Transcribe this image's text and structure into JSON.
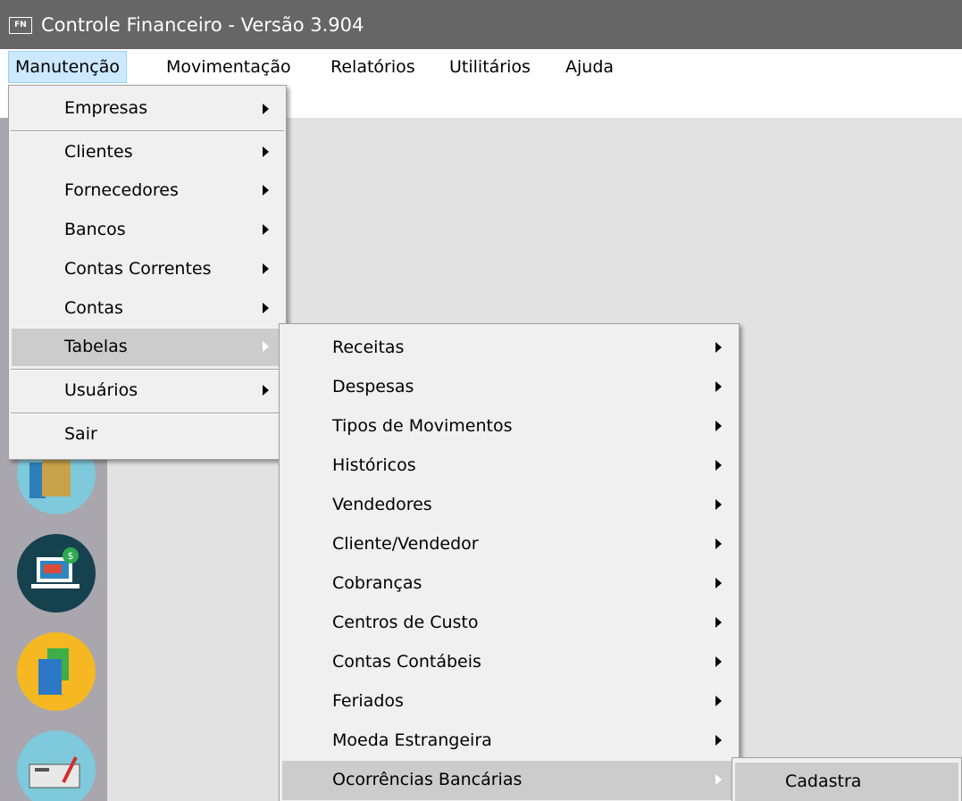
{
  "window": {
    "icon_text": "FN",
    "title": "Controle Financeiro - Versão 3.904"
  },
  "menubar": {
    "items": [
      {
        "label": "Manutenção"
      },
      {
        "label": "Movimentação"
      },
      {
        "label": "Relatórios"
      },
      {
        "label": "Utilitários"
      },
      {
        "label": "Ajuda"
      }
    ]
  },
  "manutencao_menu": {
    "items": [
      {
        "label": "Empresas"
      },
      {
        "label": "Clientes"
      },
      {
        "label": "Fornecedores"
      },
      {
        "label": "Bancos"
      },
      {
        "label": "Contas Correntes"
      },
      {
        "label": "Contas"
      },
      {
        "label": "Tabelas"
      },
      {
        "label": "Usuários"
      },
      {
        "label": "Sair"
      }
    ]
  },
  "tabelas_menu": {
    "items": [
      {
        "label": "Receitas"
      },
      {
        "label": "Despesas"
      },
      {
        "label": "Tipos de Movimentos"
      },
      {
        "label": "Históricos"
      },
      {
        "label": "Vendedores"
      },
      {
        "label": "Cliente/Vendedor"
      },
      {
        "label": "Cobranças"
      },
      {
        "label": "Centros de Custo"
      },
      {
        "label": "Contas Contábeis"
      },
      {
        "label": "Feriados"
      },
      {
        "label": "Moeda Estrangeira"
      },
      {
        "label": "Ocorrências Bancárias"
      }
    ]
  },
  "ocorrencias_menu": {
    "items": [
      {
        "label": "Cadastra"
      }
    ]
  },
  "sidebar": {
    "icons": [
      "wallet-icon",
      "laptop-dollar-icon",
      "documents-icon",
      "check-payment-icon"
    ]
  }
}
